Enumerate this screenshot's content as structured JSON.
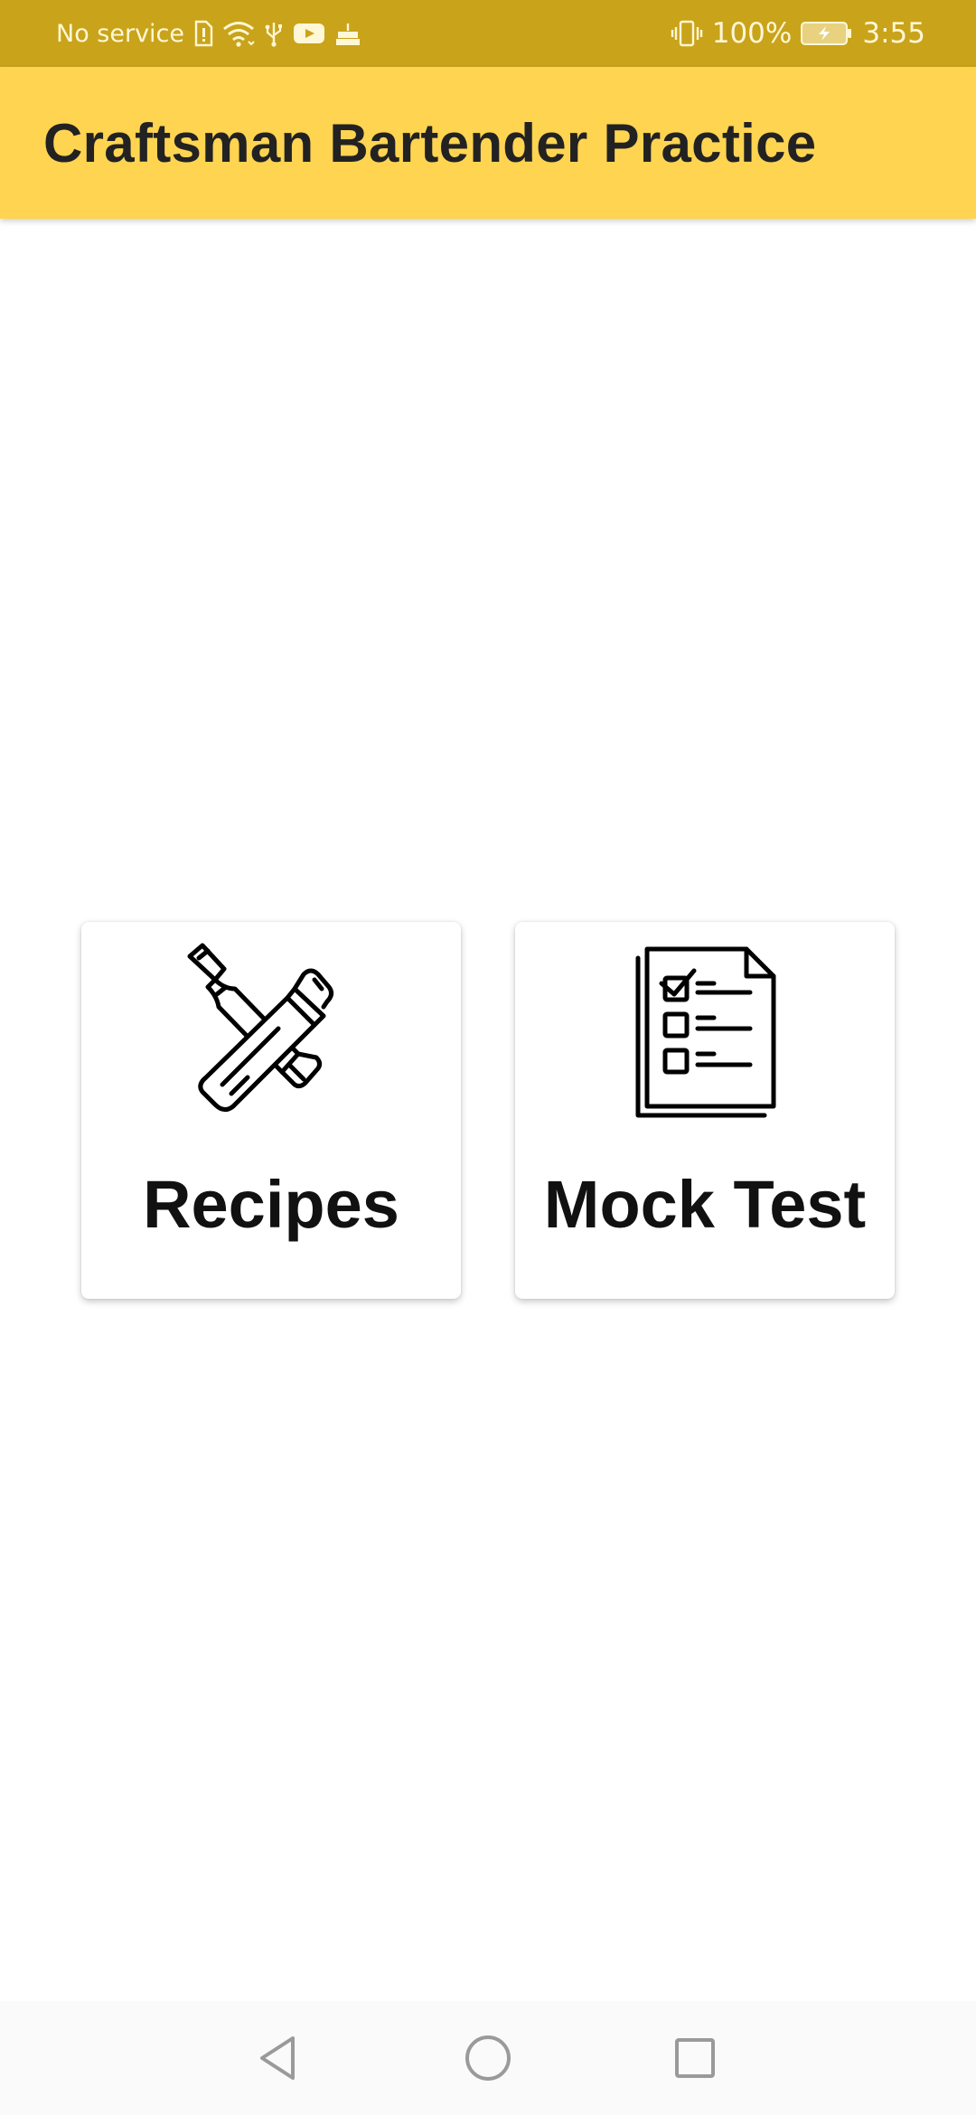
{
  "status_bar": {
    "carrier": "No service",
    "battery": "100%",
    "time": "3:55",
    "icons_left": [
      "sim-alert-icon",
      "wifi-icon",
      "usb-icon",
      "youtube-icon",
      "cake-icon"
    ],
    "icons_right": [
      "vibrate-icon",
      "battery-charging-icon"
    ],
    "background": "#c9a31a"
  },
  "app_bar": {
    "title": "Craftsman Bartender Practice",
    "background": "#ffd451"
  },
  "menu": {
    "recipes": {
      "label": "Recipes",
      "icon": "cocktail-shaker-icon"
    },
    "mock_test": {
      "label": "Mock Test",
      "icon": "checklist-icon"
    }
  },
  "nav_bar": {
    "icons": [
      "back-icon",
      "home-icon",
      "recents-icon"
    ]
  }
}
